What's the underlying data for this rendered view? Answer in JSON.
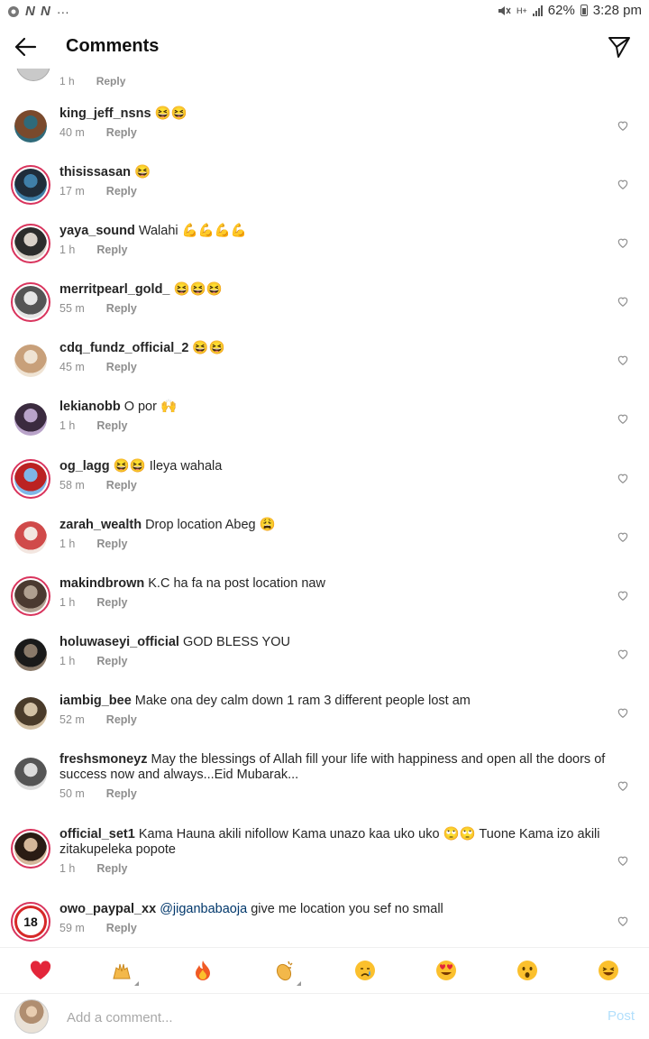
{
  "status": {
    "left_badges": "N N",
    "dots": "···",
    "signal": "H+",
    "battery": "62%",
    "time": "3:28 pm"
  },
  "header": {
    "title": "Comments"
  },
  "partial": {
    "time": "1 h",
    "reply": "Reply"
  },
  "comments": [
    {
      "user": "king_jeff_nsns",
      "text": "😆😆",
      "time": "40 m",
      "reply": "Reply",
      "ring": false,
      "av": [
        "#7a4a2d",
        "#2f6a7a"
      ]
    },
    {
      "user": "thisissasan",
      "text": "😆",
      "time": "17 m",
      "reply": "Reply",
      "ring": true,
      "av": [
        "#1f2d3a",
        "#3f7fa8"
      ]
    },
    {
      "user": "yaya_sound",
      "text": "Walahi 💪💪💪💪",
      "time": "1 h",
      "reply": "Reply",
      "ring": true,
      "av": [
        "#2c2c2c",
        "#d8d0c8"
      ]
    },
    {
      "user": "merritpearl_gold_",
      "text": "😆😆😆",
      "time": "55 m",
      "reply": "Reply",
      "ring": true,
      "av": [
        "#555",
        "#e5e5e5"
      ]
    },
    {
      "user": "cdq_fundz_official_2",
      "text": "😆😆",
      "time": "45 m",
      "reply": "Reply",
      "ring": false,
      "av": [
        "#c8a07a",
        "#efe3d3"
      ]
    },
    {
      "user": "lekianobb",
      "text": "O por 🙌",
      "time": "1 h",
      "reply": "Reply",
      "ring": false,
      "av": [
        "#3b2b3f",
        "#b9a3c9"
      ]
    },
    {
      "user": "og_lagg",
      "text": "😆😆 Ileya wahala",
      "time": "58 m",
      "reply": "Reply",
      "ring": true,
      "av": [
        "#b22",
        "#7fb6e8"
      ]
    },
    {
      "user": "zarah_wealth",
      "text": "Drop location Abeg 😩",
      "time": "1 h",
      "reply": "Reply",
      "ring": false,
      "av": [
        "#d04a4a",
        "#f3e6e0"
      ]
    },
    {
      "user": "makindbrown",
      "text": "K.C ha fa na post location naw",
      "time": "1 h",
      "reply": "Reply",
      "ring": true,
      "av": [
        "#4b3a30",
        "#b0a090"
      ]
    },
    {
      "user": "holuwaseyi_official",
      "text": "GOD BLESS YOU",
      "time": "1 h",
      "reply": "Reply",
      "ring": false,
      "av": [
        "#1a1a1a",
        "#8a7a6a"
      ]
    },
    {
      "user": "iambig_bee",
      "text": "Make ona dey calm down 1 ram 3 different people lost am",
      "time": "52 m",
      "reply": "Reply",
      "ring": false,
      "av": [
        "#4a3b2a",
        "#d3c1a5"
      ]
    },
    {
      "user": "freshsmoneyz",
      "text": "May the blessings of Allah fill your life with happiness and open all the doors of success now and always...Eid Mubarak...",
      "time": "50 m",
      "reply": "Reply",
      "ring": false,
      "av": [
        "#555",
        "#dcdcdc"
      ]
    },
    {
      "user": "official_set1",
      "text": "Kama Hauna akili nifollow Kama unazo kaa uko uko 🙄🙄 Tuone Kama izo akili zitakupeleka popote",
      "time": "1 h",
      "reply": "Reply",
      "ring": true,
      "av": [
        "#2a1c14",
        "#d4b79a"
      ]
    },
    {
      "user": "owo_paypal_xx",
      "mention": "@jiganbabaoja",
      "text": "give me location you sef no small",
      "time": "59 m",
      "reply": "Reply",
      "ring": true,
      "av": [
        "#d62828",
        "#ffffff"
      ],
      "badge": "18"
    }
  ],
  "emoji_bar": [
    {
      "name": "red-heart",
      "glyph": "heart",
      "arrow": false
    },
    {
      "name": "raising-hands",
      "glyph": "hands",
      "arrow": true
    },
    {
      "name": "fire",
      "glyph": "fire",
      "arrow": false
    },
    {
      "name": "clapping-hands",
      "glyph": "clap",
      "arrow": true
    },
    {
      "name": "crying-face",
      "glyph": "cry",
      "arrow": false
    },
    {
      "name": "heart-eyes",
      "glyph": "hearteyes",
      "arrow": false
    },
    {
      "name": "surprised-face",
      "glyph": "wow",
      "arrow": false
    },
    {
      "name": "laughing-face",
      "glyph": "laugh",
      "arrow": false
    }
  ],
  "composer": {
    "placeholder": "Add a comment...",
    "post_label": "Post"
  },
  "colors": {
    "ring": "#d9345d",
    "mention": "#00376b",
    "muted": "#8e8e8e",
    "post_disabled": "#b2dffc"
  }
}
